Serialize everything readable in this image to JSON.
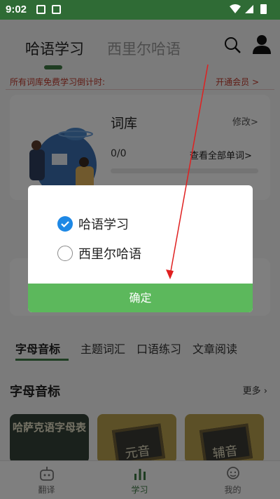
{
  "statusbar": {
    "time": "9:02"
  },
  "header": {
    "tabs": [
      {
        "label": "哈语学习"
      },
      {
        "label": "西里尔哈语"
      }
    ]
  },
  "notice": {
    "text": "所有词库免费学习倒计时:",
    "vip_link": "开通会员 >"
  },
  "vocab_card": {
    "title": "词库",
    "edit_link": "修改>",
    "count": "0/0",
    "view_all": "查看全部单词>",
    "progress": 0
  },
  "categories": [
    "字母音标",
    "主题词汇",
    "口语练习",
    "文章阅读"
  ],
  "section": {
    "title": "字母音标",
    "more": "更多"
  },
  "thumbnails": [
    {
      "text": "哈萨克语字母表"
    },
    {
      "text": "元音"
    },
    {
      "text": "辅音"
    }
  ],
  "bottom_nav": [
    {
      "label": "翻译"
    },
    {
      "label": "学习"
    },
    {
      "label": "我的"
    }
  ],
  "dialog": {
    "options": [
      {
        "label": "哈语学习",
        "checked": true
      },
      {
        "label": "西里尔哈语",
        "checked": false
      }
    ],
    "confirm_label": "确定"
  },
  "colors": {
    "brand_green": "#3f7a45",
    "confirm_green": "#5cb85c",
    "check_blue": "#1e88e5",
    "notice_red": "#c0392b"
  }
}
